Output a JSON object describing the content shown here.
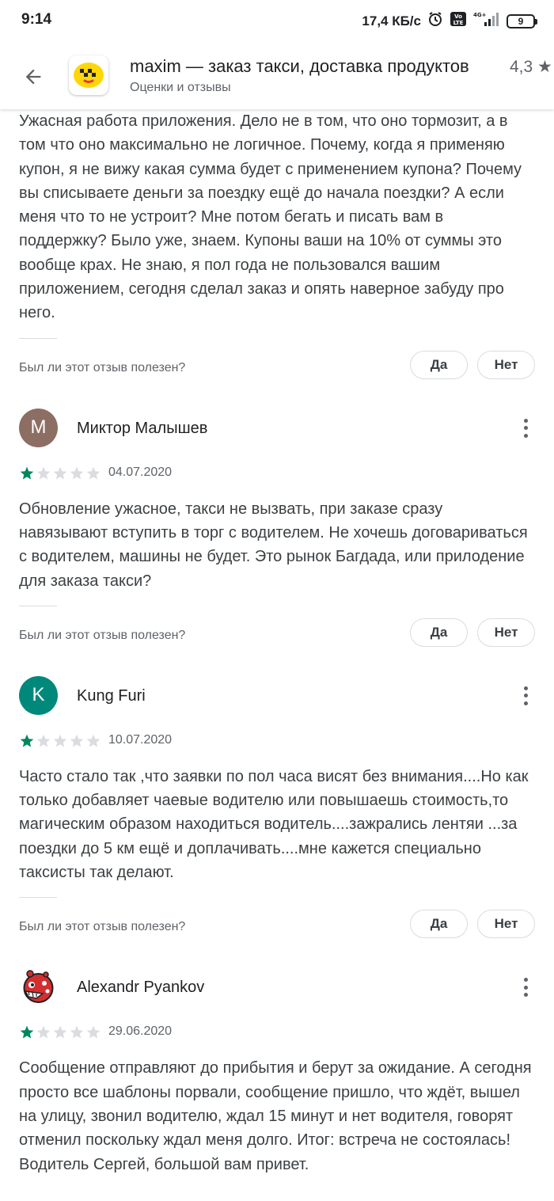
{
  "status_bar": {
    "time": "9:14",
    "speed": "17,4 КБ/с",
    "network": "4G+",
    "volte": "Vo LTE",
    "battery": "9"
  },
  "header": {
    "app_title": "maxim — заказ такси, доставка продуктов",
    "subtitle": "Оценки и отзывы",
    "rating": "4,3 ★"
  },
  "helpful": {
    "question": "Был ли этот отзыв полезен?",
    "yes": "Да",
    "no": "Нет"
  },
  "reviews": [
    {
      "text": "Ужасная работа приложения. Дело не в том, что оно тормозит, а в том что оно максимально не логичное. Почему, когда я применяю купон, я не вижу какая сумма будет с применением купона? Почему вы списываете деньги за поездку ещё до начала поездки? А если меня что то не устроит? Мне потом бегать и писать вам в поддержку? Было уже, знаем. Купоны ваши на 10% от суммы это вообще крах. Не знаю, я пол года не пользовался вашим приложением, сегодня сделал заказ и опять наверное забуду про него."
    },
    {
      "author": "Миктор Малышев",
      "initial": "M",
      "avatar_color": "#8d6e63",
      "rating": 1,
      "date": "04.07.2020",
      "text": "Обновление ужасное, такси не вызвать, при заказе сразу навязывают вступить в торг с водителем. Не хочешь договариваться с водителем, машины не будет. Это рынок Багдада, или прилодение для заказа такси?"
    },
    {
      "author": "Kung Furi",
      "initial": "K",
      "avatar_color": "#00897b",
      "rating": 1,
      "date": "10.07.2020",
      "text": "Часто стало так ,что заявки по пол часа висят без внимания....Но как только добавляет чаевые водителю или повышаешь стоимость,то магическим образом находиться водитель....зажрались лентяи ...за поездки до 5 км ещё и доплачивать....мне кажется специально таксисты так делают."
    },
    {
      "author": "Alexandr Pyankov",
      "rating": 1,
      "date": "29.06.2020",
      "text": "Сообщение отправляют до прибытия и берут за ожидание. А сегодня просто все шаблоны порвали, сообщение пришло, что ждёт, вышел на улицу, звонил водителю, ждал 15 минут и нет водителя, говорят отменил поскольку ждал меня долго. Итог: встреча не состоялась! Водитель Сергей, большой вам привет."
    }
  ],
  "colors": {
    "star_filled": "#01875f",
    "star_empty": "#dadce0",
    "app_icon": "#ffd60a"
  }
}
